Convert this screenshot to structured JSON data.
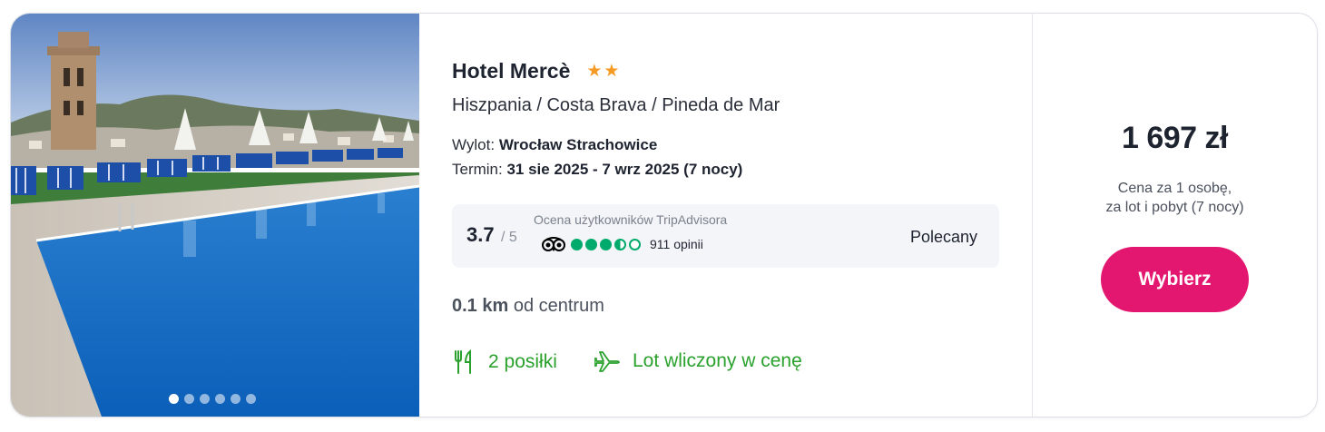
{
  "hotel": {
    "name": "Hotel Mercè",
    "stars": 2,
    "stars_glyph": "★★",
    "location": "Hiszpania / Costa Brava / Pineda de Mar"
  },
  "flight": {
    "departure_label": "Wylot:",
    "departure_value": "Wrocław Strachowice",
    "term_label": "Termin:",
    "term_value": "31 sie 2025 - 7 wrz 2025 (7 nocy)"
  },
  "rating": {
    "score": "3.7",
    "max": "/ 5",
    "source_label": "Ocena użytkowników TripAdvisora",
    "bubbles": 3.5,
    "reviews": "911 opinii",
    "badge": "Polecany"
  },
  "distance": {
    "value": "0.1 km",
    "label": "od centrum"
  },
  "features": [
    {
      "label": "2 posiłki",
      "icon": "fork-knife-icon"
    },
    {
      "label": "Lot wliczony w cenę",
      "icon": "airplane-icon"
    }
  ],
  "price": {
    "amount": "1 697 zł",
    "note_line1": "Cena za 1 osobę,",
    "note_line2": "za lot i pobyt (7 nocy)"
  },
  "cta": {
    "label": "Wybierz"
  },
  "gallery": {
    "total": 6,
    "active_index": 0
  },
  "colors": {
    "accent": "#e3176f",
    "star": "#f59a23",
    "feature": "#2aa12c",
    "tripadvisor": "#00aa6c"
  }
}
